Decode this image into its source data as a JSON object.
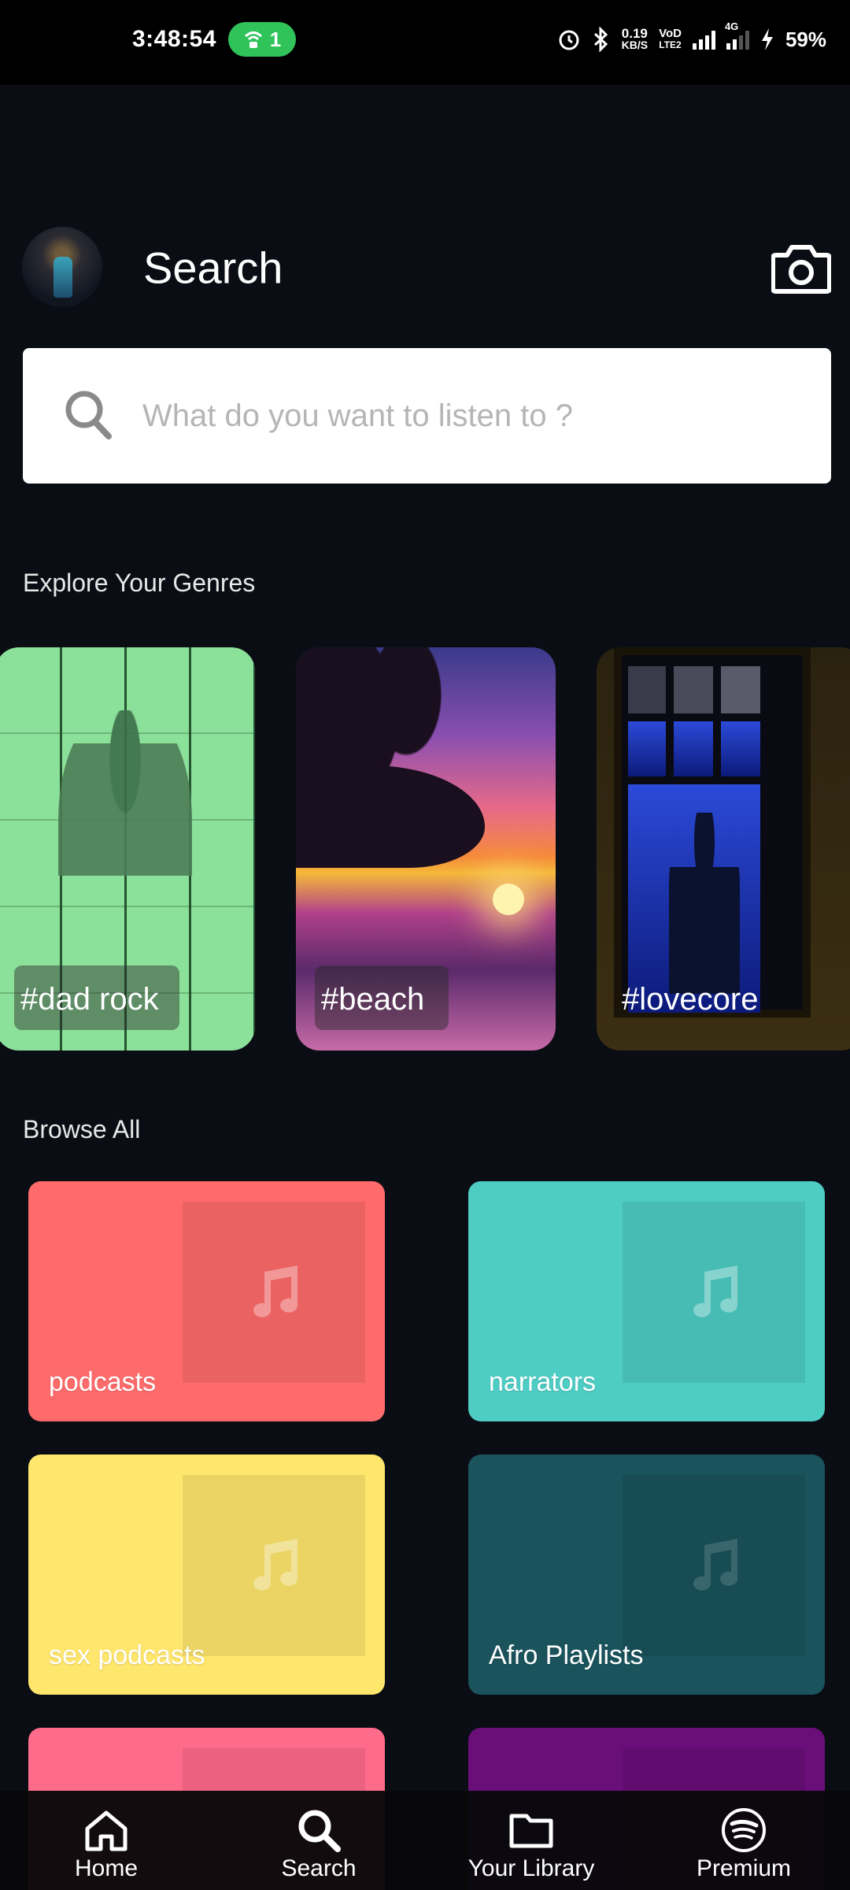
{
  "status_bar": {
    "time": "3:48:54",
    "hotspot_count": "1",
    "net_speed_top": "0.19",
    "net_speed_bottom": "KB/S",
    "volte_top": "VoD",
    "volte_bottom": "LTE2",
    "network_type": "4G",
    "battery": "59%"
  },
  "header": {
    "title": "Search"
  },
  "search": {
    "placeholder": "What do you want to listen to ?"
  },
  "genres": {
    "heading": "Explore Your Genres",
    "items": [
      {
        "label": "#dad rock",
        "color": "#8be09a"
      },
      {
        "label": "#beach",
        "color": "#e86a8a"
      },
      {
        "label": "#lovecore",
        "color": "#2b4ad8"
      }
    ]
  },
  "browse": {
    "heading": "Browse All",
    "tiles": [
      {
        "label": "podcasts",
        "color": "#ff6b6b"
      },
      {
        "label": "narrators",
        "color": "#4ecdc4"
      },
      {
        "label": "sex podcasts",
        "color": "#ffe66d"
      },
      {
        "label": "Afro Playlists",
        "color": "#1a535c"
      },
      {
        "label": "",
        "color": "#ff6b8b"
      },
      {
        "label": "",
        "color": "#6a0f7a"
      }
    ]
  },
  "nav": {
    "items": [
      {
        "label": "Home",
        "icon": "home-icon"
      },
      {
        "label": "Search",
        "icon": "search-icon"
      },
      {
        "label": "Your Library",
        "icon": "folder-icon"
      },
      {
        "label": "Premium",
        "icon": "spotify-icon"
      }
    ]
  }
}
